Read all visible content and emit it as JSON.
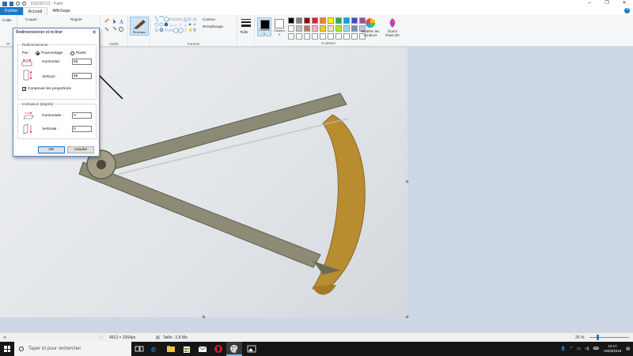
{
  "window": {
    "title": "DSC00712 - Paint",
    "controls": [
      "─",
      "❐",
      "✕"
    ]
  },
  "tabs": {
    "file": "Fichier",
    "home": "Accueil",
    "view": "Affichage",
    "help": "?"
  },
  "ribbon": {
    "clipboard": {
      "paste": "Coller",
      "cut": "Couper",
      "label": "Pr"
    },
    "image": {
      "crop": "Rogner"
    },
    "tools": {
      "label": "Outils"
    },
    "brushes": {
      "label": "Pinceaux"
    },
    "shapes": {
      "label": "Formes",
      "outline": "Contour",
      "fill": "Remplissage",
      "glyphs": [
        "╲",
        "⌒",
        "◯",
        "▭",
        "▭",
        "▭",
        "△",
        "▷",
        "◇",
        "⬠",
        "⬡",
        "⬢",
        "→",
        "←",
        "↑",
        "↓",
        "✦",
        "✧",
        "✩",
        "✪",
        "☆",
        "▭",
        "◯",
        "◯",
        "♡",
        "⚡",
        "⚲"
      ]
    },
    "size": {
      "label": "Taille"
    },
    "colors": {
      "label": "Couleurs",
      "color1": "Couleur 1",
      "color2": "Couleur 2",
      "edit": "Modifier les couleurs",
      "paint3d": "Ouvrir Paint 3D",
      "palette": [
        "#000000",
        "#7f7f7f",
        "#880015",
        "#ed1c24",
        "#ff7f27",
        "#fff200",
        "#22b14c",
        "#00a2e8",
        "#3f48cc",
        "#a349a4",
        "#ffffff",
        "#c3c3c3",
        "#b97a57",
        "#ffaec9",
        "#ffc90e",
        "#efe4b0",
        "#b5e61d",
        "#99d9ea",
        "#7092be",
        "#c8bfe7",
        "#ffffff",
        "#ffffff",
        "#ffffff",
        "#ffffff",
        "#ffffff",
        "#ffffff",
        "#ffffff",
        "#ffffff",
        "#ffffff",
        "#ffffff"
      ]
    }
  },
  "dialog": {
    "title": "Redimensionner et incliner",
    "resize_legend": "Redimensionner",
    "by_label": "Par :",
    "percent_label": "Pourcentage",
    "pixels_label": "Pixels",
    "horizontal_label": "Horizontal :",
    "horizontal_value": "85",
    "vertical_label": "Vertical :",
    "vertical_value": "85",
    "keep_ratio_label": "Conserver les proportions",
    "skew_legend": "Inclinaison (degrés)",
    "skew_h_label": "Horizontale :",
    "skew_h_value": "0",
    "skew_v_label": "Verticale :",
    "skew_v_value": "0",
    "ok": "OK",
    "cancel": "Annuler"
  },
  "statusbar": {
    "dimensions": "4912 × 3264px",
    "size": "Taille : 2,8 Mo",
    "zoom": "25 %"
  },
  "taskbar": {
    "search_placeholder": "Taper ici pour rechercher",
    "time": "12:17",
    "date": "19/03/2018"
  }
}
